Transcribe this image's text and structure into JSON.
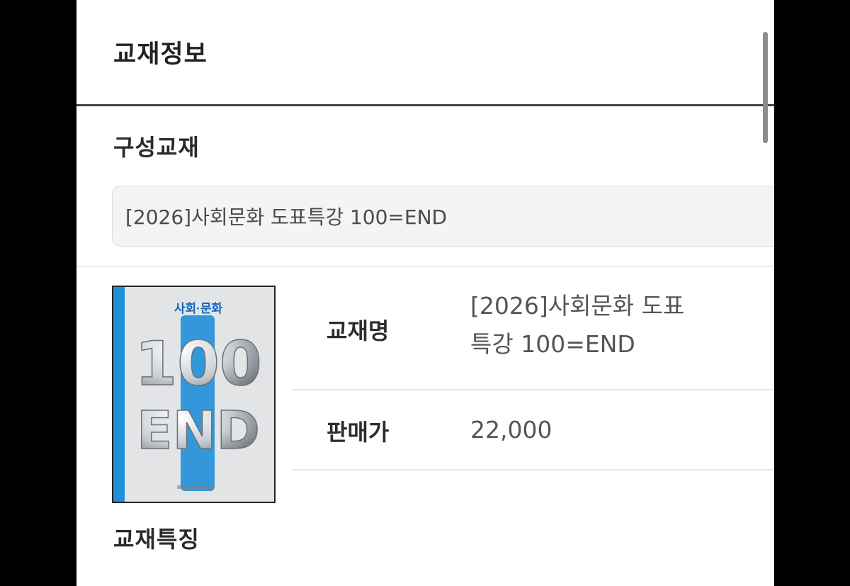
{
  "page": {
    "title": "교재정보"
  },
  "composition": {
    "title": "구성교재",
    "selected_book": "[2026]사회문화 도표특강 100=END"
  },
  "book": {
    "cover": {
      "top_text": "사회·문화",
      "big_text_top": "100",
      "big_text_bottom": "END"
    },
    "name_label": "교재명",
    "name_line1": "[2026]사회문화 도표",
    "name_line2": "특강 100=END",
    "price_label": "판매가",
    "price_value": "22,000"
  },
  "features": {
    "title": "교재특징"
  },
  "colors": {
    "cover_accent": "#1f8fd8",
    "cover_background": "#e2e4e6",
    "divider_strong": "#444444"
  }
}
